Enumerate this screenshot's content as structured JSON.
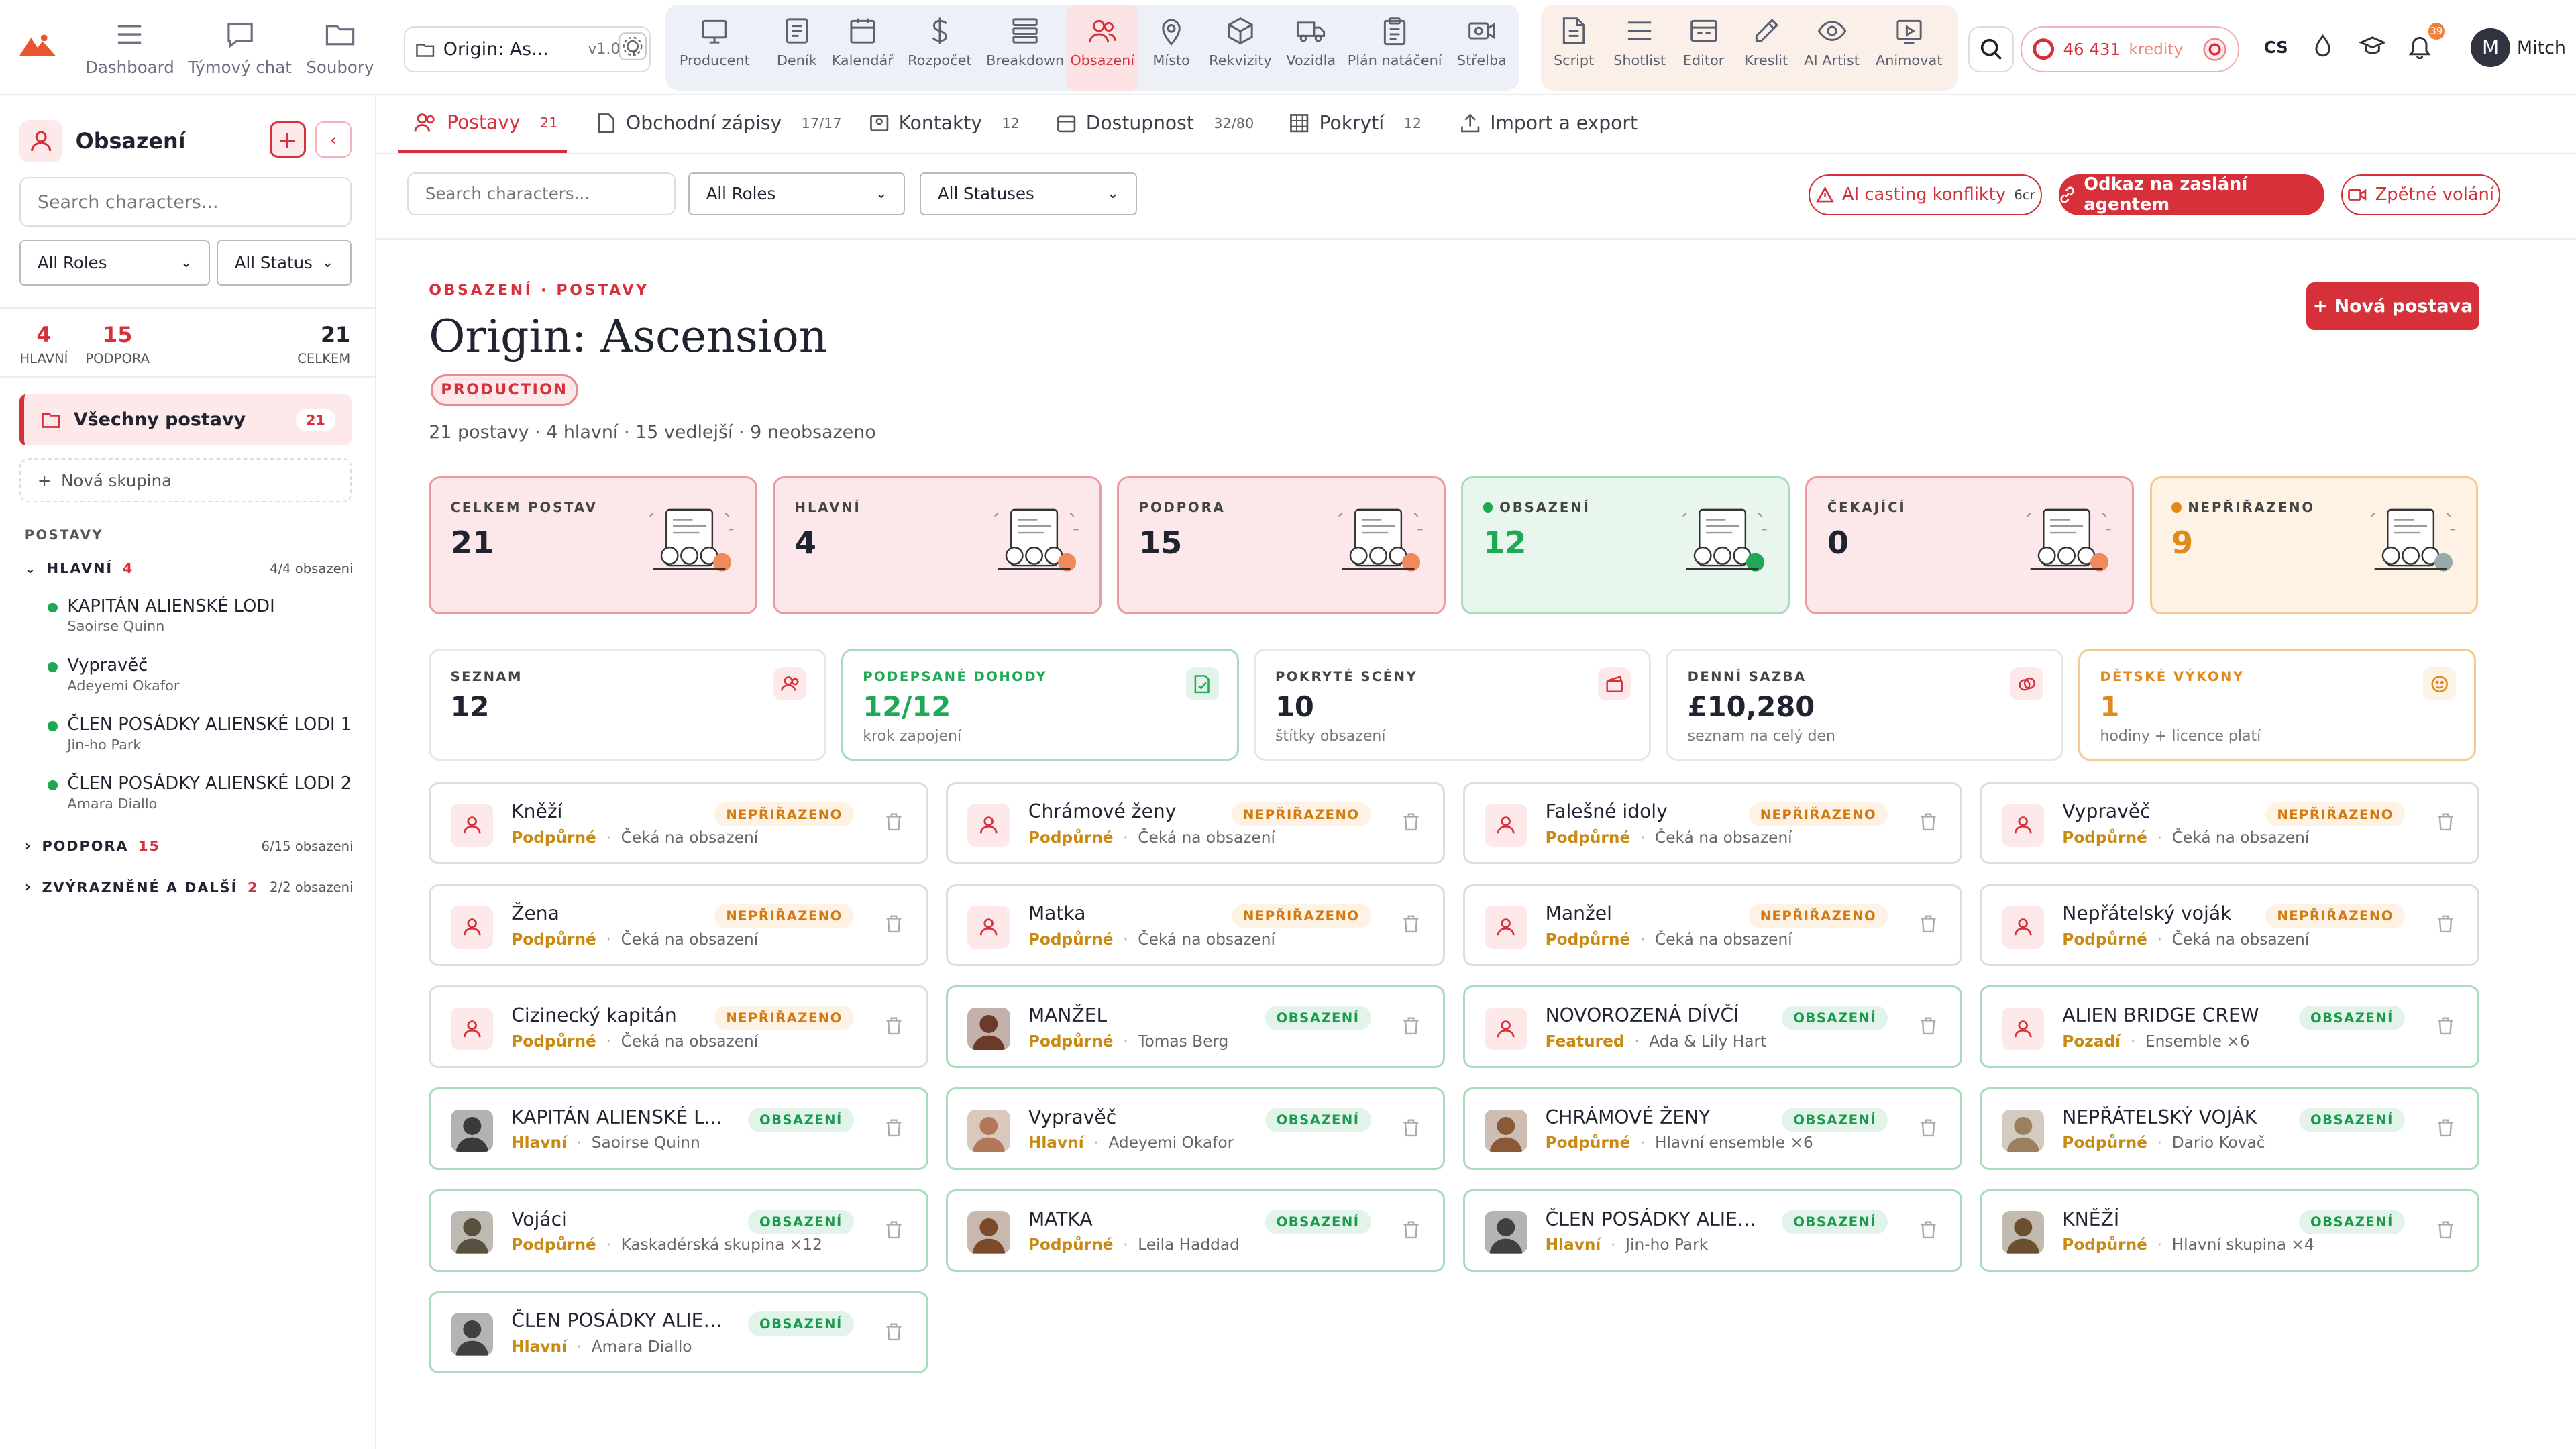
{
  "topbar": {
    "nav": [
      {
        "label": "Dashboard",
        "icon": "grid-menu-icon"
      },
      {
        "label": "Týmový chat",
        "icon": "chat-icon"
      },
      {
        "label": "Soubory",
        "icon": "folder-icon"
      }
    ],
    "project": {
      "name": "Origin: As...",
      "version": "v1.0"
    },
    "modules": [
      {
        "label": "Producent",
        "icon": "monitor-icon"
      },
      {
        "label": "Deník",
        "icon": "journal-icon"
      },
      {
        "label": "Kalendář",
        "icon": "calendar-icon"
      },
      {
        "label": "Rozpočet",
        "icon": "dollar-icon"
      },
      {
        "label": "Breakdown",
        "icon": "layers-icon"
      },
      {
        "label": "Obsazení",
        "icon": "people-icon",
        "active": true
      },
      {
        "label": "Místo",
        "icon": "pin-icon"
      },
      {
        "label": "Rekvizity",
        "icon": "cube-icon"
      },
      {
        "label": "Vozidla",
        "icon": "truck-icon"
      },
      {
        "label": "Plán natáčení",
        "icon": "clipboard-icon"
      },
      {
        "label": "Střelba",
        "icon": "camera-icon"
      }
    ],
    "tools": [
      {
        "label": "Script",
        "icon": "script-icon"
      },
      {
        "label": "Shotlist",
        "icon": "list-icon"
      },
      {
        "label": "Editor",
        "icon": "editor-icon"
      },
      {
        "label": "Kreslit",
        "icon": "pen-icon"
      },
      {
        "label": "AI Artist",
        "icon": "eye-icon"
      },
      {
        "label": "Animovat",
        "icon": "play-icon"
      }
    ],
    "credits_value": "46 431",
    "credits_label": "kredity",
    "lang": "CS",
    "notif_count": "39",
    "user_initial": "M",
    "user_name": "Mitch"
  },
  "sidebar": {
    "title": "Obsazení",
    "search_placeholder": "Search characters...",
    "role_filter": "All Roles",
    "status_filter": "All Status",
    "stats": [
      {
        "value": "4",
        "label": "HLAVNÍ"
      },
      {
        "value": "15",
        "label": "PODPORA"
      },
      {
        "value": "21",
        "label": "CELKEM"
      }
    ],
    "all_label": "Všechny postavy",
    "all_count": "21",
    "new_group": "Nová skupina",
    "section": "POSTAVY",
    "groups": [
      {
        "name": "HLAVNÍ",
        "count": "4",
        "assigned": "4/4 obsazeni"
      },
      {
        "name": "PODPORA",
        "count": "15",
        "assigned": "6/15 obsazeni"
      },
      {
        "name": "ZVÝRAZNĚNÉ A DALŠÍ",
        "count": "2",
        "assigned": "2/2 obsazeni"
      }
    ],
    "lead_chars": [
      {
        "name": "KAPITÁN ALIENSKÉ LODI",
        "actor": "Saoirse Quinn"
      },
      {
        "name": "Vypravěč",
        "actor": "Adeyemi Okafor"
      },
      {
        "name": "ČLEN POSÁDKY ALIENSKÉ LODI 1",
        "actor": "Jin-ho Park"
      },
      {
        "name": "ČLEN POSÁDKY ALIENSKÉ LODI 2",
        "actor": "Amara Diallo"
      }
    ]
  },
  "tabs": [
    {
      "label": "Postavy",
      "count": "21",
      "active": true
    },
    {
      "label": "Obchodní zápisy",
      "count": "17/17"
    },
    {
      "label": "Kontakty",
      "count": "12"
    },
    {
      "label": "Dostupnost",
      "count": "32/80"
    },
    {
      "label": "Pokrytí",
      "count": "12"
    },
    {
      "label": "Import a export",
      "count": ""
    }
  ],
  "filters": {
    "search_placeholder": "Search characters...",
    "roles": "All Roles",
    "statuses": "All Statuses"
  },
  "actions": {
    "ai_conflicts": "AI casting konflikty",
    "ai_cost": "6cr",
    "agent_link": "Odkaz na zaslání agentem",
    "callback": "Zpětné volání"
  },
  "header": {
    "breadcrumb": "OBSAZENÍ · POSTAVY",
    "title": "Origin: Ascension",
    "status": "PRODUCTION",
    "summary": "21 postavy · 4 hlavní · 15 vedlejší · 9 neobsazeno",
    "new_char": "+ Nová postava"
  },
  "big_stats": [
    {
      "label": "CELKEM POSTAV",
      "value": "21",
      "style": "red"
    },
    {
      "label": "HLAVNÍ",
      "value": "4",
      "style": "red"
    },
    {
      "label": "PODPORA",
      "value": "15",
      "style": "red"
    },
    {
      "label": "OBSAZENÍ",
      "value": "12",
      "style": "green"
    },
    {
      "label": "ČEKAJÍCÍ",
      "value": "0",
      "style": "red"
    },
    {
      "label": "NEPŘIŘAZENO",
      "value": "9",
      "style": "orange"
    }
  ],
  "small_stats": [
    {
      "label": "SEZNAM",
      "value": "12",
      "sub": "",
      "style": "plain"
    },
    {
      "label": "PODEPSANÉ DOHODY",
      "value": "12/12",
      "sub": "krok zapojení",
      "style": "green"
    },
    {
      "label": "POKRYTÉ SCÉNY",
      "value": "10",
      "sub": "štítky obsazení",
      "style": "plain"
    },
    {
      "label": "DENNÍ SAZBA",
      "value": "£10,280",
      "sub": "seznam na celý den",
      "style": "plain"
    },
    {
      "label": "DĚTSKÉ VÝKONY",
      "value": "1",
      "sub": "hodiny + licence platí",
      "style": "orange"
    }
  ],
  "colors": {
    "accent": "#d6303a",
    "cast": "#1fa955",
    "unassigned": "#e08a1e"
  },
  "characters": [
    {
      "name": "Kněží",
      "role": "Podpůrné",
      "actor": "Čeká na obsazení",
      "status": "NEPŘIŘAZENO",
      "photo": "placeholder"
    },
    {
      "name": "Chrámové ženy",
      "role": "Podpůrné",
      "actor": "Čeká na obsazení",
      "status": "NEPŘIŘAZENO",
      "photo": "placeholder"
    },
    {
      "name": "Falešné idoly",
      "role": "Podpůrné",
      "actor": "Čeká na obsazení",
      "status": "NEPŘIŘAZENO",
      "photo": "placeholder"
    },
    {
      "name": "Vypravěč",
      "role": "Podpůrné",
      "actor": "Čeká na obsazení",
      "status": "NEPŘIŘAZENO",
      "photo": "placeholder"
    },
    {
      "name": "Žena",
      "role": "Podpůrné",
      "actor": "Čeká na obsazení",
      "status": "NEPŘIŘAZENO",
      "photo": "placeholder"
    },
    {
      "name": "Matka",
      "role": "Podpůrné",
      "actor": "Čeká na obsazení",
      "status": "NEPŘIŘAZENO",
      "photo": "placeholder"
    },
    {
      "name": "Manžel",
      "role": "Podpůrné",
      "actor": "Čeká na obsazení",
      "status": "NEPŘIŘAZENO",
      "photo": "placeholder"
    },
    {
      "name": "Nepřátelský voják",
      "role": "Podpůrné",
      "actor": "Čeká na obsazení",
      "status": "NEPŘIŘAZENO",
      "photo": "placeholder"
    },
    {
      "name": "Cizinecký kapitán",
      "role": "Podpůrné",
      "actor": "Čeká na obsazení",
      "status": "NEPŘIŘAZENO",
      "photo": "placeholder"
    },
    {
      "name": "MANŽEL",
      "role": "Podpůrné",
      "actor": "Tomas Berg",
      "status": "OBSAZENÍ",
      "photo": "#6b3a28"
    },
    {
      "name": "NOVOROZENÁ DÍVČÍ",
      "role": "Featured",
      "actor": "Ada & Lily Hart",
      "status": "OBSAZENÍ",
      "photo": "placeholder"
    },
    {
      "name": "ALIEN BRIDGE CREW",
      "role": "Pozadí",
      "actor": "Ensemble ×6",
      "status": "OBSAZENÍ",
      "photo": "placeholder"
    },
    {
      "name": "KAPITÁN ALIENSKÉ LODI",
      "role": "Hlavní",
      "actor": "Saoirse Quinn",
      "status": "OBSAZENÍ",
      "photo": "#3a3a3a"
    },
    {
      "name": "Vypravěč",
      "role": "Hlavní",
      "actor": "Adeyemi Okafor",
      "status": "OBSAZENÍ",
      "photo": "#b07858"
    },
    {
      "name": "CHRÁMOVÉ ŽENY",
      "role": "Podpůrné",
      "actor": "Hlavní ensemble ×6",
      "status": "OBSAZENÍ",
      "photo": "#8a5a38"
    },
    {
      "name": "NEPŘÁTELSKÝ VOJÁK",
      "role": "Podpůrné",
      "actor": "Dario Kovač",
      "status": "OBSAZENÍ",
      "photo": "#9a8060"
    },
    {
      "name": "Vojáci",
      "role": "Podpůrné",
      "actor": "Kaskadérská skupina ×12",
      "status": "OBSAZENÍ",
      "photo": "#5a5040"
    },
    {
      "name": "MATKA",
      "role": "Podpůrné",
      "actor": "Leila Haddad",
      "status": "OBSAZENÍ",
      "photo": "#7a4a2a"
    },
    {
      "name": "ČLEN POSÁDKY ALIENSK...",
      "role": "Hlavní",
      "actor": "Jin-ho Park",
      "status": "OBSAZENÍ",
      "photo": "#404040"
    },
    {
      "name": "KNĚŽÍ",
      "role": "Podpůrné",
      "actor": "Hlavní skupina ×4",
      "status": "OBSAZENÍ",
      "photo": "#6a5030"
    },
    {
      "name": "ČLEN POSÁDKY ALIENSK...",
      "role": "Hlavní",
      "actor": "Amara Diallo",
      "status": "OBSAZENÍ",
      "photo": "#404040"
    }
  ]
}
